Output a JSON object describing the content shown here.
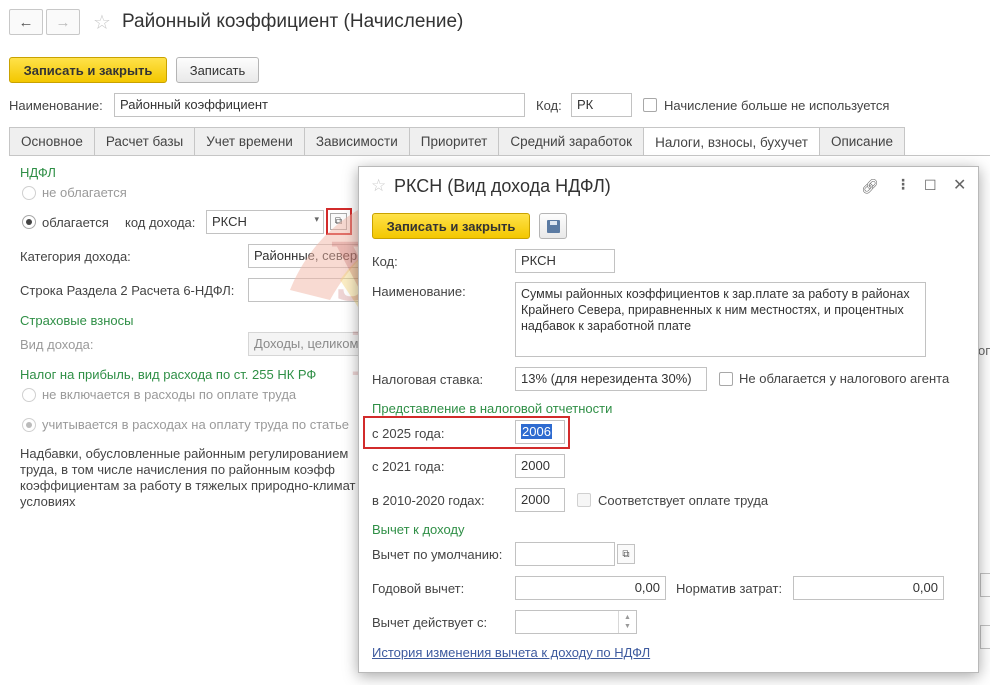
{
  "window": {
    "title": "Районный коэффициент (Начисление)",
    "back_icon": "←",
    "forward_icon": "→",
    "star_icon": "☆"
  },
  "toolbar": {
    "save_close_label": "Записать и закрыть",
    "save_label": "Записать"
  },
  "header": {
    "name_label": "Наименование:",
    "name_value": "Районный коэффициент",
    "code_label": "Код:",
    "code_value": "РК",
    "not_used_label": "Начисление больше не используется"
  },
  "tabs": [
    {
      "label": "Основное"
    },
    {
      "label": "Расчет базы"
    },
    {
      "label": "Учет времени"
    },
    {
      "label": "Зависимости"
    },
    {
      "label": "Приоритет"
    },
    {
      "label": "Средний заработок"
    },
    {
      "label": "Налоги, взносы, бухучет"
    },
    {
      "label": "Описание"
    }
  ],
  "main": {
    "ndfl_header": "НДФЛ",
    "not_taxed_label": "не облагается",
    "taxed_label": "облагается",
    "income_code_label": "код дохода:",
    "income_code_value": "РКСН",
    "income_category_label": "Категория дохода:",
    "income_category_value": "Районные, север",
    "row_6ndfl_label": "Строка Раздела 2 Расчета 6-НДФЛ:",
    "insurance_header": "Страховые взносы",
    "income_type_label": "Вид дохода:",
    "income_type_value": "Доходы, целиком",
    "profit_tax_header": "Налог на прибыль, вид расхода по ст. 255 НК РФ",
    "not_included_label": "не включается в расходы по оплате труда",
    "included_label": "учитывается в расходах на оплату труда по статье",
    "description_lines": [
      "Надбавки, обусловленные районным регулированием",
      "труда, в том числе начисления по районным коэфф",
      "коэффициентам за работу в тяжелых природно-климат",
      "условиях"
    ],
    "right_edge_text": "оп"
  },
  "dialog": {
    "title": "РКСН (Вид дохода НДФЛ)",
    "save_close_label": "Записать и закрыть",
    "code_label": "Код:",
    "code_value": "РКСН",
    "name_label": "Наименование:",
    "name_value": "Суммы районных коэффициентов к зар.плате за работу в районах Крайнего Севера, приравненных к ним местностях, и процентных надбавок к заработной плате",
    "tax_rate_label": "Налоговая ставка:",
    "tax_rate_value": "13% (для нерезидента 30%)",
    "not_taxed_agent_label": "Не облагается у налогового агента",
    "reporting_header": "Представление в налоговой отчетности",
    "from_2025_label": "с 2025 года:",
    "from_2025_value": "2006",
    "from_2021_label": "с 2021 года:",
    "from_2021_value": "2000",
    "years_2010_2020_label": "в 2010-2020 годах:",
    "years_2010_2020_value": "2000",
    "labor_payment_label": "Соответствует оплате труда",
    "deduction_header": "Вычет к доходу",
    "default_deduction_label": "Вычет по умолчанию:",
    "default_deduction_value": "",
    "annual_deduction_label": "Годовой вычет:",
    "annual_deduction_value": "0,00",
    "cost_norm_label": "Норматив затрат:",
    "cost_norm_value": "0,00",
    "deduction_from_label": "Вычет действует с:",
    "deduction_from_value": "",
    "history_link": "История изменения вычета к доходу по НДФЛ"
  },
  "colors": {
    "accent_yellow": "#f3c700",
    "section_green": "#2f8f46",
    "highlight_red": "#d22b2b",
    "selection_blue": "#2e6bd0"
  }
}
